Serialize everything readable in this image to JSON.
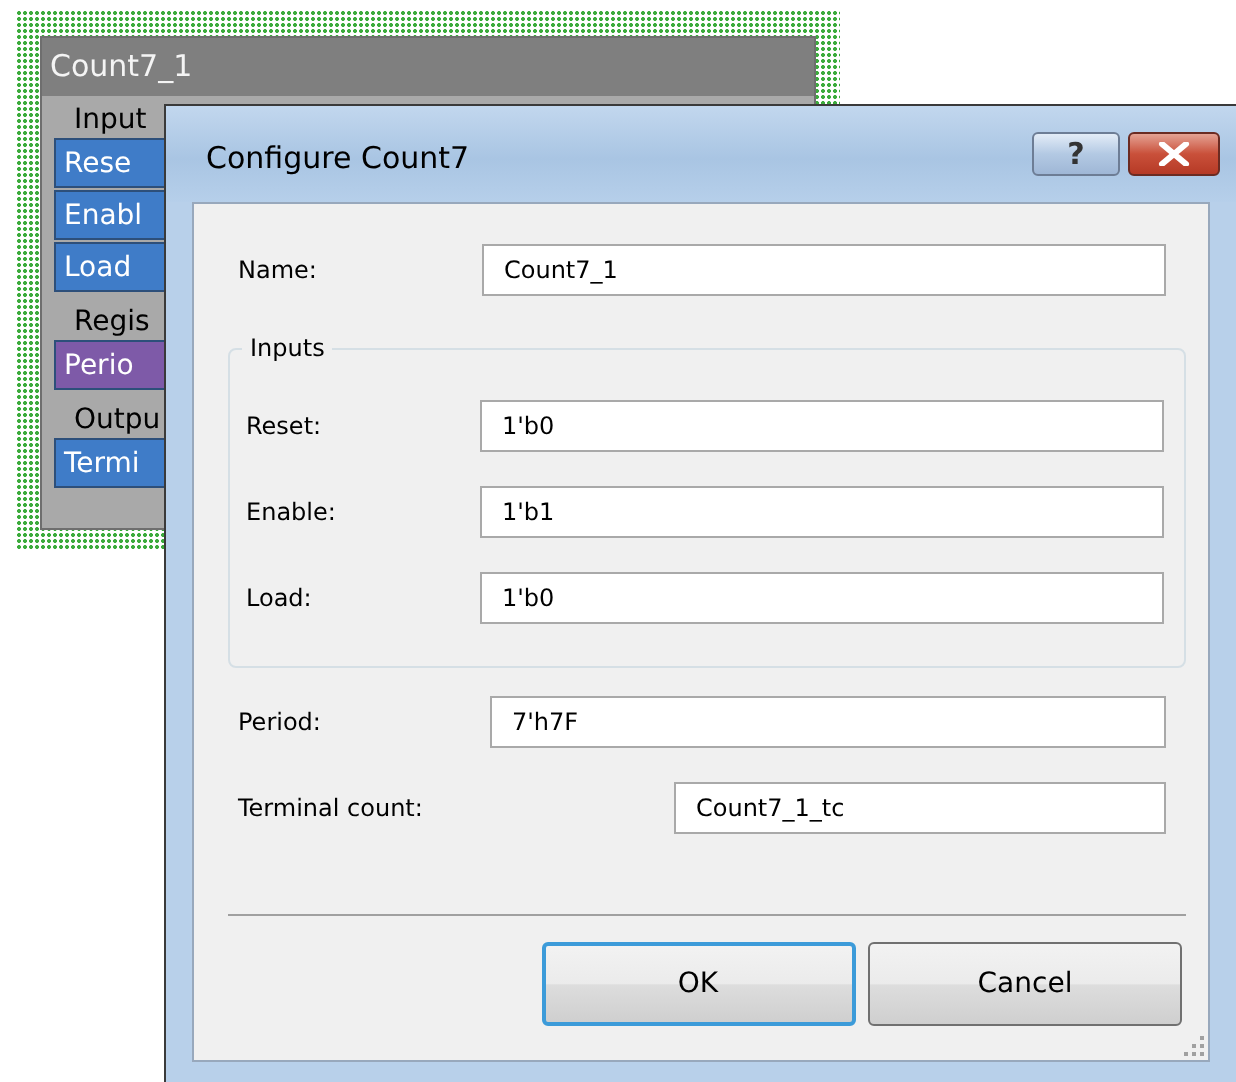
{
  "canvas": {
    "component": {
      "title": "Count7_1",
      "selected": true,
      "sections": [
        {
          "label": "Input",
          "items": [
            {
              "label": "Rese",
              "color": "#3f7cc8"
            },
            {
              "label": "Enabl",
              "color": "#3f7cc8"
            },
            {
              "label": "Load",
              "color": "#3f7cc8"
            }
          ]
        },
        {
          "label": "Regis",
          "items": [
            {
              "label": "Perio",
              "color": "#7e5aa8"
            }
          ]
        },
        {
          "label": "Outpu",
          "items": [
            {
              "label": "Termi",
              "color": "#3f7cc8"
            }
          ]
        }
      ]
    }
  },
  "dialog": {
    "title": "Configure Count7",
    "help_button": "?",
    "name": {
      "label": "Name:",
      "value": "Count7_1"
    },
    "inputs_group": {
      "legend": "Inputs",
      "fields": [
        {
          "label": "Reset:",
          "value": "1'b0"
        },
        {
          "label": "Enable:",
          "value": "1'b1"
        },
        {
          "label": "Load:",
          "value": "1'b0"
        }
      ]
    },
    "period": {
      "label": "Period:",
      "value": "7'h7F"
    },
    "terminal_count": {
      "label": "Terminal count:",
      "value": "Count7_1_tc"
    },
    "buttons": [
      {
        "label": "OK",
        "default": true
      },
      {
        "label": "Cancel",
        "default": false
      }
    ]
  }
}
